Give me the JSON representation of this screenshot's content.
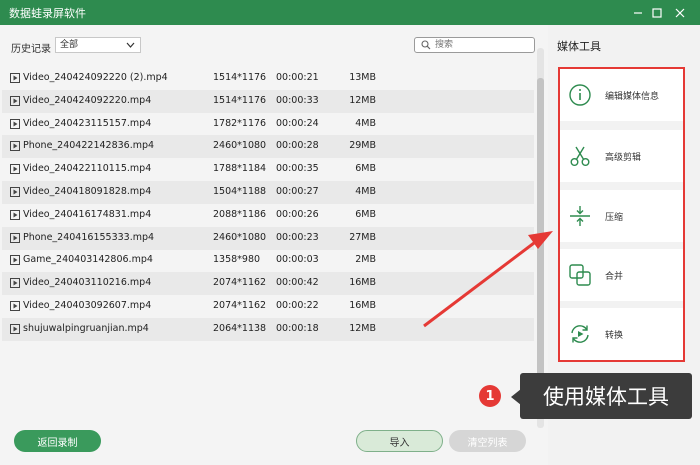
{
  "window": {
    "title": "数据蛙录屏软件"
  },
  "filter": {
    "label": "历史记录",
    "selected": "全部",
    "search_placeholder": "搜索"
  },
  "columns": [
    "name",
    "resolution",
    "duration",
    "size"
  ],
  "files": [
    {
      "name": "Video_240424092220 (2).mp4",
      "resolution": "1514*1176",
      "duration": "00:00:21",
      "size": "13MB"
    },
    {
      "name": "Video_240424092220.mp4",
      "resolution": "1514*1176",
      "duration": "00:00:33",
      "size": "12MB"
    },
    {
      "name": "Video_240423115157.mp4",
      "resolution": "1782*1176",
      "duration": "00:00:24",
      "size": "4MB"
    },
    {
      "name": "Phone_240422142836.mp4",
      "resolution": "2460*1080",
      "duration": "00:00:28",
      "size": "29MB"
    },
    {
      "name": "Video_240422110115.mp4",
      "resolution": "1788*1184",
      "duration": "00:00:35",
      "size": "6MB"
    },
    {
      "name": "Video_240418091828.mp4",
      "resolution": "1504*1188",
      "duration": "00:00:27",
      "size": "4MB"
    },
    {
      "name": "Video_240416174831.mp4",
      "resolution": "2088*1186",
      "duration": "00:00:26",
      "size": "6MB"
    },
    {
      "name": "Phone_240416155333.mp4",
      "resolution": "2460*1080",
      "duration": "00:00:23",
      "size": "27MB"
    },
    {
      "name": "Game_240403142806.mp4",
      "resolution": "1358*980",
      "duration": "00:00:03",
      "size": "2MB"
    },
    {
      "name": "Video_240403110216.mp4",
      "resolution": "2074*1162",
      "duration": "00:00:42",
      "size": "16MB"
    },
    {
      "name": "Video_240403092607.mp4",
      "resolution": "2074*1162",
      "duration": "00:00:22",
      "size": "16MB"
    },
    {
      "name": "shujuwalpingruanjian.mp4",
      "resolution": "2064*1138",
      "duration": "00:00:18",
      "size": "12MB"
    }
  ],
  "buttons": {
    "back": "返回录制",
    "import": "导入",
    "clear": "清空列表"
  },
  "side": {
    "title": "媒体工具",
    "tools": [
      {
        "label": "编辑媒体信息",
        "icon": "info-icon"
      },
      {
        "label": "高级剪辑",
        "icon": "scissors-icon"
      },
      {
        "label": "压缩",
        "icon": "compress-icon"
      },
      {
        "label": "合并",
        "icon": "merge-icon"
      },
      {
        "label": "转换",
        "icon": "convert-icon"
      }
    ]
  },
  "annotation": {
    "step": "1",
    "text": "使用媒体工具"
  },
  "colors": {
    "titlebar": "#2e8b4f",
    "accent": "#3a9a5c",
    "highlight": "#e53935"
  }
}
